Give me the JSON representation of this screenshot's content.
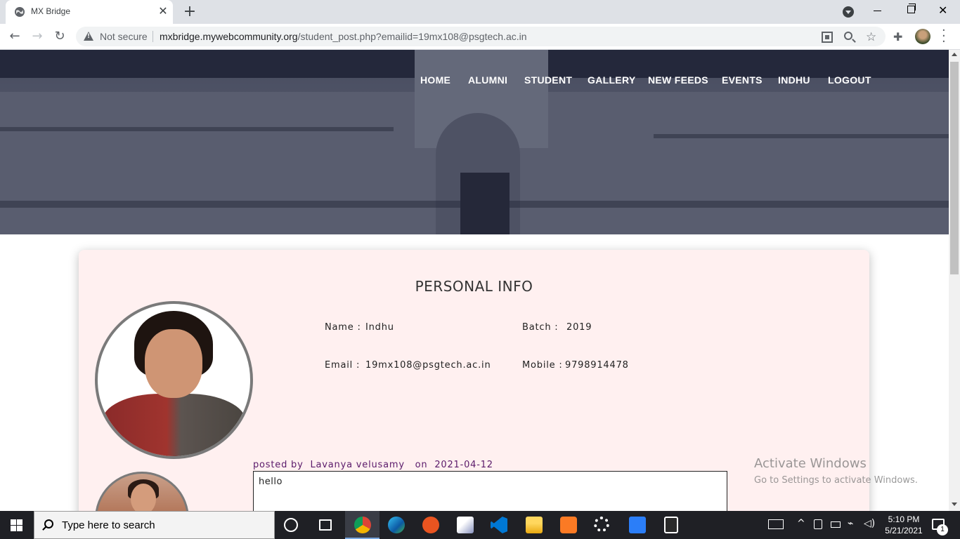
{
  "browser": {
    "tab_title": "MX Bridge",
    "tab_close": "✕",
    "new_tab": "+",
    "security_label": "Not secure",
    "url_host": "mxbridge.mywebcommunity.org",
    "url_path": "/student_post.php?emailid=19mx108@psgtech.ac.in"
  },
  "nav": {
    "items": [
      "HOME",
      "ALUMNI",
      "STUDENT",
      "GALLERY",
      "NEW FEEDS",
      "EVENTS",
      "INDHU",
      "LOGOUT"
    ]
  },
  "card": {
    "title": "PERSONAL INFO",
    "name_label": "Name :",
    "name_value": "Indhu",
    "batch_label": "Batch :",
    "batch_value": "2019",
    "email_label": "Email :",
    "email_value": "19mx108@psgtech.ac.in",
    "mobile_label": "Mobile :",
    "mobile_value": "9798914478"
  },
  "post": {
    "posted_by_label": "posted by",
    "author": "Lavanya velusamy",
    "on_label": "on",
    "date": "2021-04-12",
    "body": "hello"
  },
  "watermark": {
    "line1": "Activate Windows",
    "line2": "Go to Settings to activate Windows."
  },
  "taskbar": {
    "search_placeholder": "Type here to search",
    "time": "5:10 PM",
    "date": "5/21/2021",
    "notification_count": "1"
  },
  "colors": {
    "card_bg": "#fff0f0",
    "post_meta": "#5a1a6a",
    "taskbar_bg": "#1f2025"
  },
  "icons": [
    "globe-icon",
    "warning-icon",
    "qr-icon",
    "zoom-icon",
    "star-icon",
    "puzzle-icon",
    "kebab-icon",
    "windows-start-icon",
    "cortana-icon",
    "task-view-icon",
    "chrome-icon",
    "edge-icon",
    "ubuntu-icon",
    "php-icon",
    "vscode-icon",
    "file-explorer-icon",
    "xampp-icon",
    "settings-icon",
    "wps-icon",
    "calculator-icon"
  ]
}
